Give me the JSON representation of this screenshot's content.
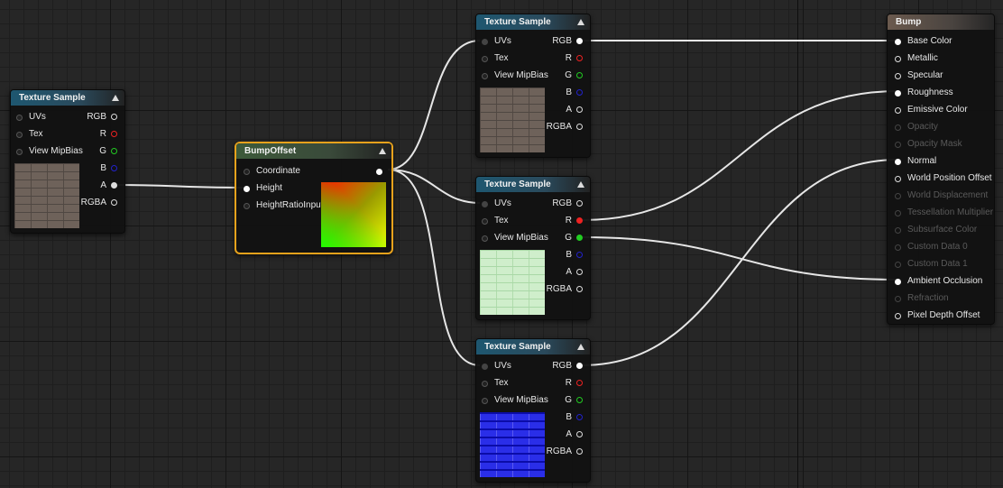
{
  "nodes": {
    "tex_left": {
      "title": "Texture Sample",
      "inputs": [
        "UVs",
        "Tex",
        "View MipBias"
      ],
      "outputs": [
        "RGB",
        "R",
        "G",
        "B",
        "A",
        "RGBA"
      ]
    },
    "bump_offset": {
      "title": "BumpOffset",
      "inputs": [
        "Coordinate",
        "Height",
        "HeightRatioInput"
      ]
    },
    "tex_top": {
      "title": "Texture Sample",
      "inputs": [
        "UVs",
        "Tex",
        "View MipBias"
      ],
      "outputs": [
        "RGB",
        "R",
        "G",
        "B",
        "A",
        "RGBA"
      ]
    },
    "tex_mid": {
      "title": "Texture Sample",
      "inputs": [
        "UVs",
        "Tex",
        "View MipBias"
      ],
      "outputs": [
        "RGB",
        "R",
        "G",
        "B",
        "A",
        "RGBA"
      ]
    },
    "tex_bot": {
      "title": "Texture Sample",
      "inputs": [
        "UVs",
        "Tex",
        "View MipBias"
      ],
      "outputs": [
        "RGB",
        "R",
        "G",
        "B",
        "A",
        "RGBA"
      ]
    },
    "material": {
      "title": "Bump",
      "inputs": [
        "Base Color",
        "Metallic",
        "Specular",
        "Roughness",
        "Emissive Color",
        "Opacity",
        "Opacity Mask",
        "Normal",
        "World Position Offset",
        "World Displacement",
        "Tessellation Multiplier",
        "Subsurface Color",
        "Custom Data 0",
        "Custom Data 1",
        "Ambient Occlusion",
        "Refraction",
        "Pixel Depth Offset"
      ]
    }
  },
  "colors": {
    "selected_border": "#e8a21c",
    "pin_red": "#e22",
    "pin_green": "#2c2",
    "pin_blue": "#22c",
    "wire": "#e6e6e6"
  }
}
